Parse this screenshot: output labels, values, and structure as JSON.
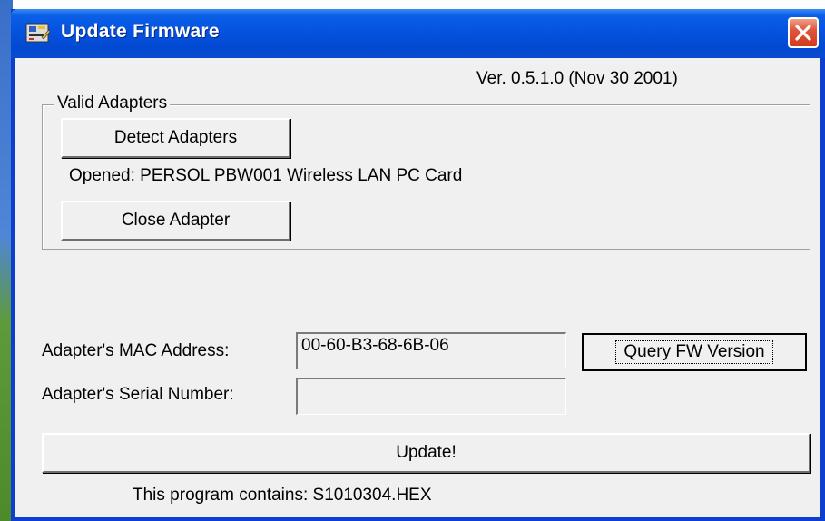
{
  "window": {
    "title": "Update Firmware",
    "version": "Ver. 0.5.1.0  (Nov 30 2001)"
  },
  "adapters_group": {
    "label": "Valid Adapters",
    "detect_label": "Detect Adapters",
    "opened_text": "Opened: PERSOL PBW001 Wireless LAN PC Card",
    "close_label": "Close Adapter"
  },
  "details": {
    "mac_label": "Adapter's MAC Address:",
    "mac_value": "00-60-B3-68-6B-06",
    "query_label": "Query FW Version",
    "serial_label": "Adapter's Serial Number:",
    "serial_value": ""
  },
  "footer": {
    "update_label": "Update!",
    "contains_text": "This program contains: S1010304.HEX"
  },
  "colors": {
    "titlebar": "#0553e0",
    "client": "#f0f0f0",
    "close_button": "#e0553a"
  },
  "icons": [
    "app-icon",
    "close-icon"
  ]
}
